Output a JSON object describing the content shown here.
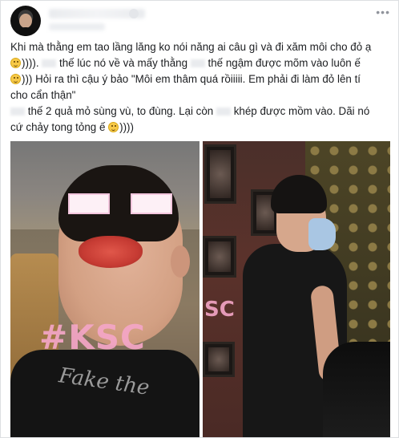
{
  "post": {
    "author_name": "",
    "lines": [
      {
        "text": "Khi mà thằng em tao lầng lăng ko nói năng ai câu gì và đi xăm môi cho đỏ ạ",
        "has_smile": false
      },
      {
        "text": ")))). ",
        "mid": " thế lúc nó về và mấy thằng ",
        "mid2": " thế ngậm được mõm vào luôn ế"
      },
      {
        "text": "))) Hỏi ra thì cậu ý bảo \"Môi em thâm quá rồiiiii. Em phải đi làm đỏ lên tí"
      },
      {
        "text": "cho cẩn thận\""
      },
      {
        "text": " thế 2 quả mỏ sùng vù, to đùng. Lại còn ",
        "mid": " khép được mồm vào. Dãi nó"
      },
      {
        "text": "cứ chảy tong tỏng ế ",
        "end": "))))"
      }
    ]
  },
  "photos": {
    "left_watermark": "#KSC",
    "left_shirt_text": "Fake the",
    "right_watermark": "SC"
  },
  "icons": {
    "more": "more-options-icon",
    "smile": "smile-emoji-icon"
  },
  "colors": {
    "watermark": "#f4a6c7",
    "text": "#1c1e21"
  }
}
